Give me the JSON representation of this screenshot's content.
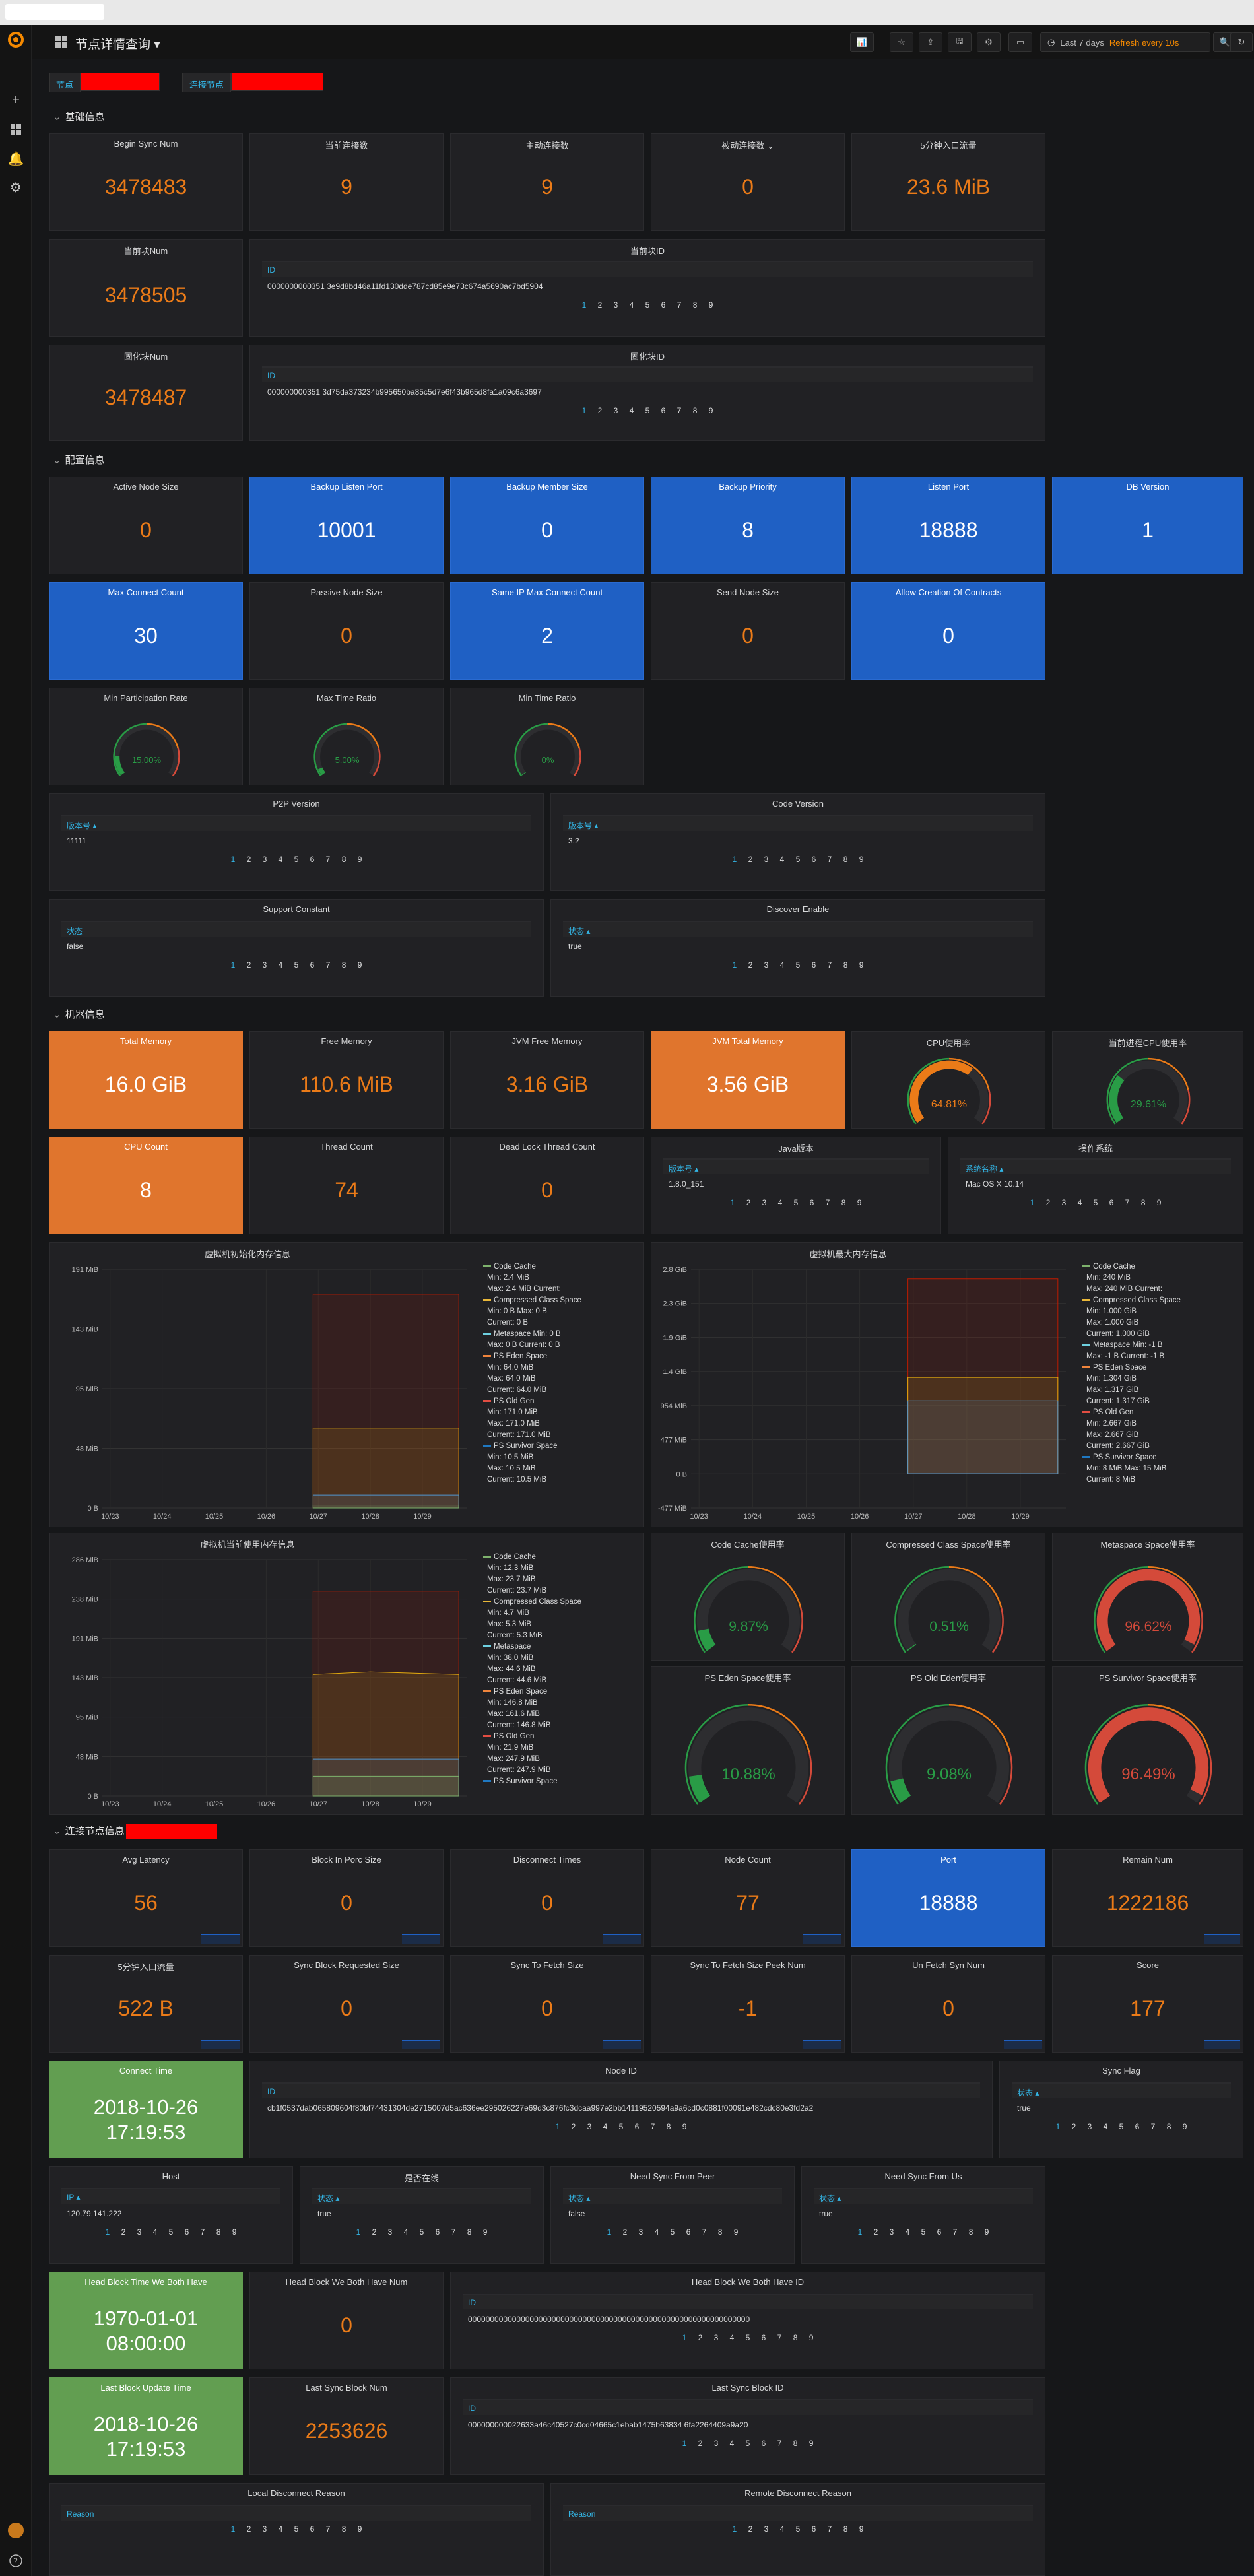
{
  "nav": {
    "title": "节点详情查询 ▾",
    "time_range": "Last 7 days",
    "refresh": "Refresh every 10s"
  },
  "vars": {
    "node_label": "节点",
    "conn_label": "连接节点"
  },
  "rows": {
    "basic": "基础信息",
    "config": "配置信息",
    "machine": "机器信息",
    "conn": "连接节点信息"
  },
  "basic": {
    "begin_sync": {
      "title": "Begin Sync Num",
      "value": "3478483"
    },
    "cur_conn": {
      "title": "当前连接数",
      "value": "9"
    },
    "active_conn": {
      "title": "主动连接数",
      "value": "9"
    },
    "passive_conn": {
      "title": "被动连接数 ⌄",
      "value": "0"
    },
    "flow": {
      "title": "5分钟入口流量",
      "value": "23.6 MiB"
    },
    "cur_block_num": {
      "title": "当前块Num",
      "value": "3478505"
    },
    "cur_block_id": {
      "title": "当前块ID",
      "col": "ID",
      "row": "0000000000351 3e9d8bd46a11fd130dde787cd85e9e73c674a5690ac7bd5904"
    },
    "solid_block_num": {
      "title": "固化块Num",
      "value": "3478487"
    },
    "solid_block_id": {
      "title": "固化块ID",
      "col": "ID",
      "row": "000000000351 3d75da373234b995650ba85c5d7e6f43b965d8fa1a09c6a3697"
    }
  },
  "config": {
    "active_node": {
      "title": "Active Node Size",
      "value": "0"
    },
    "backup_port": {
      "title": "Backup Listen Port",
      "value": "10001"
    },
    "backup_member": {
      "title": "Backup Member Size",
      "value": "0"
    },
    "backup_priority": {
      "title": "Backup Priority",
      "value": "8"
    },
    "listen_port": {
      "title": "Listen Port",
      "value": "18888"
    },
    "db_version": {
      "title": "DB Version",
      "value": "1"
    },
    "max_conn": {
      "title": "Max Connect Count",
      "value": "30"
    },
    "passive_node": {
      "title": "Passive Node Size",
      "value": "0"
    },
    "same_ip": {
      "title": "Same IP Max Connect Count",
      "value": "2"
    },
    "send_node": {
      "title": "Send Node Size",
      "value": "0"
    },
    "allow_contracts": {
      "title": "Allow Creation Of Contracts",
      "value": "0"
    },
    "min_part": {
      "title": "Min Participation Rate",
      "value": "15.00%"
    },
    "max_time": {
      "title": "Max Time Ratio",
      "value": "5.00%"
    },
    "min_time": {
      "title": "Min Time Ratio",
      "value": "0%"
    },
    "p2p": {
      "title": "P2P Version",
      "col": "版本号 ▴",
      "row": "11111"
    },
    "code": {
      "title": "Code Version",
      "col": "版本号 ▴",
      "row": "3.2"
    },
    "support": {
      "title": "Support Constant",
      "col": "状态",
      "row": "false"
    },
    "discover": {
      "title": "Discover Enable",
      "col": "状态 ▴",
      "row": "true"
    }
  },
  "machine": {
    "total_mem": {
      "title": "Total Memory",
      "value": "16.0 GiB"
    },
    "free_mem": {
      "title": "Free Memory",
      "value": "110.6 MiB"
    },
    "jvm_free": {
      "title": "JVM Free Memory",
      "value": "3.16 GiB"
    },
    "jvm_total": {
      "title": "JVM Total Memory",
      "value": "3.56 GiB"
    },
    "cpu": {
      "title": "CPU使用率",
      "value": "64.81%"
    },
    "proc_cpu": {
      "title": "当前进程CPU使用率",
      "value": "29.61%"
    },
    "cpu_count": {
      "title": "CPU Count",
      "value": "8"
    },
    "thread": {
      "title": "Thread Count",
      "value": "74"
    },
    "deadlock": {
      "title": "Dead Lock Thread Count",
      "value": "0"
    },
    "java": {
      "title": "Java版本",
      "col": "版本号 ▴",
      "row": "1.8.0_151"
    },
    "os": {
      "title": "操作系统",
      "col": "系统名称 ▴",
      "row": "Mac OS X 10.14"
    },
    "gauges": {
      "code_cache": {
        "title": "Code Cache使用率",
        "value": "9.87%"
      },
      "class_space": {
        "title": "Compressed Class Space使用率",
        "value": "0.51%"
      },
      "metaspace": {
        "title": "Metaspace Space使用率",
        "value": "96.62%"
      },
      "eden": {
        "title": "PS Eden Space使用率",
        "value": "10.88%"
      },
      "old": {
        "title": "PS Old Eden使用率",
        "value": "9.08%"
      },
      "survivor": {
        "title": "PS Survivor Space使用率",
        "value": "96.49%"
      }
    }
  },
  "conn": {
    "avg_latency": {
      "title": "Avg Latency",
      "value": "56"
    },
    "block_porc": {
      "title": "Block In Porc Size",
      "value": "0"
    },
    "disconnect": {
      "title": "Disconnect Times",
      "value": "0"
    },
    "node_count": {
      "title": "Node Count",
      "value": "77"
    },
    "port": {
      "title": "Port",
      "value": "18888"
    },
    "remain": {
      "title": "Remain Num",
      "value": "1222186"
    },
    "flow5": {
      "title": "5分钟入口流量",
      "value": "522 B"
    },
    "sync_req": {
      "title": "Sync Block Requested Size",
      "value": "0"
    },
    "sync_fetch": {
      "title": "Sync To Fetch Size",
      "value": "0"
    },
    "sync_peek": {
      "title": "Sync To Fetch Size Peek Num",
      "value": "-1"
    },
    "unfetch": {
      "title": "Un Fetch Syn Num",
      "value": "0"
    },
    "score": {
      "title": "Score",
      "value": "177"
    },
    "connect_time": {
      "title": "Connect Time",
      "value1": "2018-10-26",
      "value2": "17:19:53"
    },
    "node_id": {
      "title": "Node ID",
      "col": "ID",
      "row": "cb1f0537dab065809604f80bf74431304de2715007d5ac636ee295026227e69d3c876fc3dcaa997e2bb14119520594a9a6cd0c0881f00091e482cdc80e3fd2a2"
    },
    "sync_flag": {
      "title": "Sync Flag",
      "col": "状态 ▴",
      "row": "true"
    },
    "host": {
      "title": "Host",
      "col": "IP ▴",
      "row": "120.79.141.222"
    },
    "online": {
      "title": "是否在线",
      "col": "状态 ▴",
      "row": "true"
    },
    "need_peer": {
      "title": "Need Sync From Peer",
      "col": "状态 ▴",
      "row": "false"
    },
    "need_us": {
      "title": "Need Sync From Us",
      "col": "状态 ▴",
      "row": "true"
    },
    "head_time": {
      "title": "Head Block Time We Both Have",
      "value1": "1970-01-01",
      "value2": "08:00:00"
    },
    "head_num": {
      "title": "Head Block We Both Have Num",
      "value": "0"
    },
    "head_id": {
      "title": "Head Block We Both Have ID",
      "col": "ID",
      "row": "0000000000000000000000000000000000000000000000000000000000000000"
    },
    "last_update": {
      "title": "Last Block Update Time",
      "value1": "2018-10-26",
      "value2": "17:19:53"
    },
    "last_sync_num": {
      "title": "Last Sync Block Num",
      "value": "2253626"
    },
    "last_sync_id": {
      "title": "Last Sync Block ID",
      "col": "ID",
      "row": "000000000022633a46c40527c0cd04665c1ebab1475b63834 6fa2264409a9a20"
    },
    "local_reason": {
      "title": "Local Disconnect Reason",
      "col": "Reason"
    },
    "remote_reason": {
      "title": "Remote Disconnect Reason",
      "col": "Reason"
    }
  },
  "pager": {
    "first": "1",
    "rest": "2 3 4 5 6 7 8 9"
  },
  "charts": {
    "init_mem": {
      "title": "虚拟机初始化内存信息",
      "y_ticks": [
        "191 MiB",
        "143 MiB",
        "95 MiB",
        "48 MiB",
        "0 B"
      ],
      "legend": [
        "Code Cache",
        "Min: 2.4 MiB",
        "Max: 2.4 MiB  Current:",
        "Compressed Class Space",
        "Min: 0 B  Max: 0 B",
        "Current: 0 B",
        "Metaspace  Min: 0 B",
        "Max: 0 B  Current: 0 B",
        "PS Eden Space",
        "Min: 64.0 MiB",
        "Max: 64.0 MiB",
        "Current: 64.0 MiB",
        "PS Old Gen",
        "Min: 171.0 MiB",
        "Max: 171.0 MiB",
        "Current: 171.0 MiB",
        "PS Survivor Space",
        "Min: 10.5 MiB",
        "Max: 10.5 MiB",
        "Current: 10.5 MiB"
      ]
    },
    "max_mem": {
      "title": "虚拟机最大内存信息",
      "y_ticks": [
        "2.8 GiB",
        "2.3 GiB",
        "1.9 GiB",
        "1.4 GiB",
        "954 MiB",
        "477 MiB",
        "0 B",
        "-477 MiB"
      ],
      "legend": [
        "Code Cache",
        "Min: 240 MiB",
        "Max: 240 MiB  Current:",
        "Compressed Class Space",
        "Min: 1.000 GiB",
        "Max: 1.000 GiB",
        "Current: 1.000 GiB",
        "Metaspace  Min: -1 B",
        "Max: -1 B  Current: -1 B",
        "PS Eden Space",
        "Min: 1.304 GiB",
        "Max: 1.317 GiB",
        "Current: 1.317 GiB",
        "PS Old Gen",
        "Min: 2.667 GiB",
        "Max: 2.667 GiB",
        "Current: 2.667 GiB",
        "PS Survivor Space",
        "Min: 8 MiB  Max: 15 MiB",
        "Current: 8 MiB"
      ]
    },
    "used_mem": {
      "title": "虚拟机当前使用内存信息",
      "y_ticks": [
        "286 MiB",
        "238 MiB",
        "191 MiB",
        "143 MiB",
        "95 MiB",
        "48 MiB",
        "0 B"
      ],
      "legend": [
        "Code Cache",
        "Min: 12.3 MiB",
        "Max: 23.7 MiB",
        "Current: 23.7 MiB",
        "Compressed Class Space",
        "Min: 4.7 MiB",
        "Max: 5.3 MiB",
        "Current: 5.3 MiB",
        "Metaspace",
        "Min: 38.0 MiB",
        "Max: 44.6 MiB",
        "Current: 44.6 MiB",
        "PS Eden Space",
        "Min: 146.8 MiB",
        "Max: 161.6 MiB",
        "Current: 146.8 MiB",
        "PS Old Gen",
        "Min: 21.9 MiB",
        "Max: 247.9 MiB",
        "Current: 247.9 MiB",
        "PS Survivor Space"
      ]
    },
    "x_ticks": [
      "10/23",
      "10/24",
      "10/25",
      "10/26",
      "10/27",
      "10/28",
      "10/29"
    ]
  },
  "chart_data": [
    {
      "type": "area",
      "title": "虚拟机初始化内存信息",
      "x": [
        "10/23",
        "10/24",
        "10/25",
        "10/26",
        "10/27",
        "10/28",
        "10/29"
      ],
      "ylim": [
        0,
        191
      ],
      "series": [
        {
          "name": "PS Old Gen",
          "values": [
            null,
            null,
            null,
            null,
            171,
            171,
            171
          ]
        },
        {
          "name": "PS Eden Space",
          "values": [
            null,
            null,
            null,
            null,
            64,
            64,
            64
          ]
        },
        {
          "name": "PS Survivor Space",
          "values": [
            null,
            null,
            null,
            null,
            10.5,
            10.5,
            10.5
          ]
        },
        {
          "name": "Code Cache",
          "values": [
            null,
            null,
            null,
            null,
            2.4,
            2.4,
            2.4
          ]
        }
      ]
    },
    {
      "type": "area",
      "title": "虚拟机最大内存信息",
      "x": [
        "10/23",
        "10/24",
        "10/25",
        "10/26",
        "10/27",
        "10/28",
        "10/29"
      ],
      "ylim": [
        -0.47,
        2.8
      ],
      "series": [
        {
          "name": "PS Old Gen",
          "values": [
            null,
            null,
            null,
            null,
            2.667,
            2.667,
            2.667
          ]
        },
        {
          "name": "PS Eden Space",
          "values": [
            null,
            null,
            null,
            null,
            1.317,
            1.317,
            1.317
          ]
        },
        {
          "name": "Compressed Class Space",
          "values": [
            null,
            null,
            null,
            null,
            1.0,
            1.0,
            1.0
          ]
        }
      ]
    },
    {
      "type": "area",
      "title": "虚拟机当前使用内存信息",
      "x": [
        "10/23",
        "10/24",
        "10/25",
        "10/26",
        "10/27",
        "10/28",
        "10/29"
      ],
      "ylim": [
        0,
        286
      ],
      "series": [
        {
          "name": "PS Old Gen",
          "values": [
            null,
            null,
            null,
            null,
            247.9,
            247.9,
            247.9
          ]
        },
        {
          "name": "PS Eden Space",
          "values": [
            null,
            null,
            null,
            null,
            146.8,
            150,
            146.8
          ]
        },
        {
          "name": "Metaspace",
          "values": [
            null,
            null,
            null,
            null,
            44.6,
            44.6,
            44.6
          ]
        },
        {
          "name": "Code Cache",
          "values": [
            null,
            null,
            null,
            null,
            23.7,
            23.7,
            23.7
          ]
        }
      ]
    }
  ]
}
